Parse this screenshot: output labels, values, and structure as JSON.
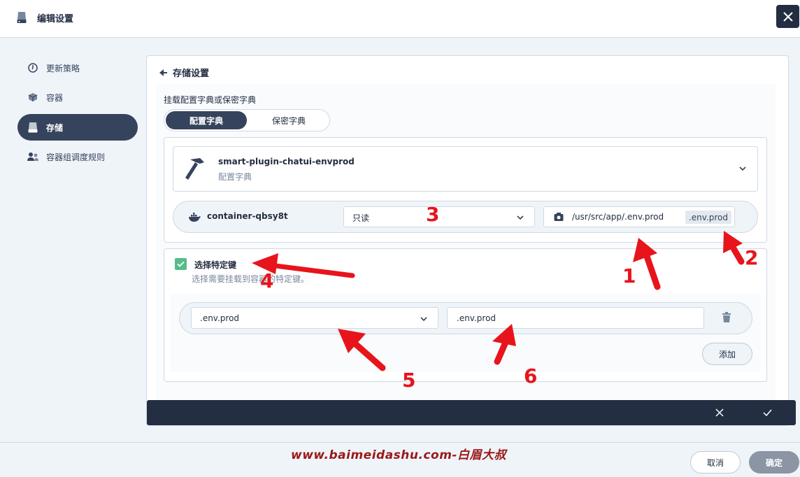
{
  "header": {
    "title": "编辑设置"
  },
  "sidebar": {
    "items": [
      {
        "label": "更新策略",
        "icon": "update-strategy-icon",
        "active": false
      },
      {
        "label": "容器",
        "icon": "container-icon",
        "active": false
      },
      {
        "label": "存储",
        "icon": "storage-icon",
        "active": true
      },
      {
        "label": "容器组调度规则",
        "icon": "pod-scheduling-icon",
        "active": false
      }
    ]
  },
  "main": {
    "section_title": "存储设置",
    "mount_label": "挂载配置字典或保密字典",
    "segment": {
      "selected": "配置字典",
      "other": "保密字典"
    },
    "config_map": {
      "name": "smart-plugin-chatui-envprod",
      "type": "配置字典"
    },
    "mount": {
      "container": "container-qbsy8t",
      "access_mode": "只读",
      "mount_path": "/usr/src/app/.env.prod",
      "path_tag": ".env.prod"
    },
    "specific_keys": {
      "checked": true,
      "label": "选择特定键",
      "description": "选择需要挂载到容器的特定键。",
      "key": ".env.prod",
      "path": ".env.prod",
      "add_label": "添加"
    }
  },
  "footer": {
    "cancel_label": "取消",
    "ok_label": "确定",
    "watermark": "www.baimeidashu.com-白眉大叔"
  },
  "annotations": [
    "1",
    "2",
    "3",
    "4",
    "5",
    "6"
  ],
  "colors": {
    "dark": "#242e42",
    "accent_green": "#55bc8a",
    "annotation_red": "#e8141c",
    "watermark": "#9b1818"
  }
}
